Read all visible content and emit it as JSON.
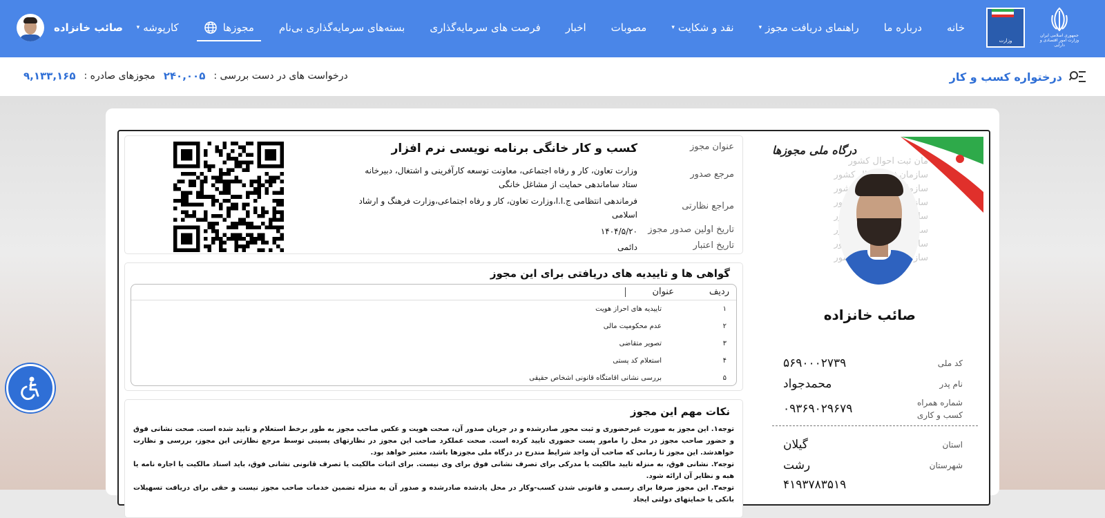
{
  "nav": {
    "emblem_caption": "جمهوری اسلامی ایران\nوزارت امور اقتصادی و دارایی",
    "ministry_logo_text": "وزارت",
    "items": [
      {
        "label": "خانه",
        "caret": false
      },
      {
        "label": "درباره ما",
        "caret": false
      },
      {
        "label": "راهنمای دریافت مجوز",
        "caret": true
      },
      {
        "label": "نقد و شکایت",
        "caret": true
      },
      {
        "label": "مصوبات",
        "caret": false
      },
      {
        "label": "اخبار",
        "caret": false
      },
      {
        "label": "فرصت های سرمایه‌گذاری",
        "caret": false
      },
      {
        "label": "بسته‌های سرمایه‌گذاری بی‌نام",
        "caret": false
      },
      {
        "label": "مجوزها",
        "caret": false,
        "active": true,
        "globe": true
      },
      {
        "label": "کارپوشه",
        "caret": true
      }
    ],
    "user_name": "صائب خانزاده"
  },
  "subheader": {
    "title": "درختواره کسب و کار",
    "pending_label": "درخواست های در دست بررسی :",
    "pending_value": "۲۴۰,۰۰۵",
    "issued_label": "مجوزهای صادره :",
    "issued_value": "۹,۱۳۳,۱۶۵"
  },
  "profile": {
    "portal_logo": "درگاه ملی مجوزها",
    "watermark": [
      "مان ثبت احوال کشور",
      "سازمان ثبت احوال کشور",
      "سازمان ثبت احوال کشور",
      "سازمان ثبت احوال کشور",
      "سازمان ثبت احوال کشور",
      "سازمان ثبت احوال کشور",
      "سازمان ثبت احوال کشور",
      "سازمان ثبت احوال کشور"
    ],
    "name": "صائب خانزاده",
    "national_id_label": "کد ملی",
    "national_id": "۵۶۹۰۰۰۲۷۳۹",
    "father_label": "نام پدر",
    "father": "محمدجواد",
    "mobile_label": "شماره همراه\nکسب و کاری",
    "mobile": "۰۹۳۶۹۰۲۹۶۷۹",
    "province_label": "استان",
    "province": "گیلان",
    "city_label": "شهرستان",
    "city": "رشت",
    "partial_value": "۴۱۹۳۷۸۳۵۱۹"
  },
  "license": {
    "title_label": "عنوان مجوز",
    "title": "کسب و کار خانگی برنامه نویسی نرم افزار",
    "issuer_label": "مرجع صدور",
    "issuer": "وزارت تعاون، کار و رفاه اجتماعی، معاونت توسعه کارآفرینی و اشتغال، دبیرخانه ستاد ساماندهی حمایت از مشاغل خانگی",
    "supervisors_label": "مراجع نظارتی",
    "supervisors": "فرماندهی انتظامی ج.ا.ا،وزارت تعاون، کار و رفاه اجتماعی،وزارت فرهنگ و ارشاد اسلامی",
    "first_issue_label": "تاریخ اولین صدور مجوز",
    "first_issue": "۱۴۰۴/۵/۲۰",
    "validity_label": "تاریخ اعتبار",
    "validity": "دائمی"
  },
  "certificates": {
    "title": "گواهی ها و تاییدیه های دریافتی برای این مجوز",
    "col_index": "ردیف",
    "col_title": "عنوان",
    "rows": [
      {
        "index": "۱",
        "title": "تاییدیه های احراز هویت"
      },
      {
        "index": "۲",
        "title": "عدم محکومیت مالی"
      },
      {
        "index": "۳",
        "title": "تصویر متقاضی"
      },
      {
        "index": "۴",
        "title": "استعلام کد پستی"
      },
      {
        "index": "۵",
        "title": "بررسی نشانی اقامتگاه قانونی اشخاص حقیقی"
      }
    ]
  },
  "notes": {
    "title": "نکات مهم این مجوز",
    "text": "توجه۱. این مجوز به صورت غیرحضوری و ثبت محور صادرشده و در جریان صدور آن، صحت هویت و عکس صاحب مجوز به طور برخط استعلام و تایید شده است. صحت نشانی فوق و حضور صاحب مجوز در محل را مامور پست حضوری تایید کرده است. صحت عملکرد صاحب این مجوز در نظارتهای پسینی توسط مرجع نظارتی این مجوز، بررسی و نظارت خواهدشد. این مجوز تا زمانی که صاحب آن واجد شرایط مندرج در درگاه ملی مجوزها باشد، معتبر خواهد بود.\nتوجه۲. نشانی فوق، به منزله تایید مالکیت یا مدرکی برای تصرف نشانی فوق برای وی نیست. برای اثبات مالکیت یا تصرف قانونی نشانی فوق، باید اسناد مالکیت یا اجاره نامه یا هبه و نظایر آن ارائه شود.\nتوجه۳. این مجوز صرفا برای رسمی و قانونی شدن کسب-وکار در محل یادشده صادرشده و صدور آن به منزله تضمین خدمات صاحب مجوز نیست و حقی برای دریافت تسهیلات بانکی یا حمایتهای دولتی ایجاد"
  },
  "colors": {
    "primary": "#4a86e8",
    "link": "#2f6fd6"
  }
}
